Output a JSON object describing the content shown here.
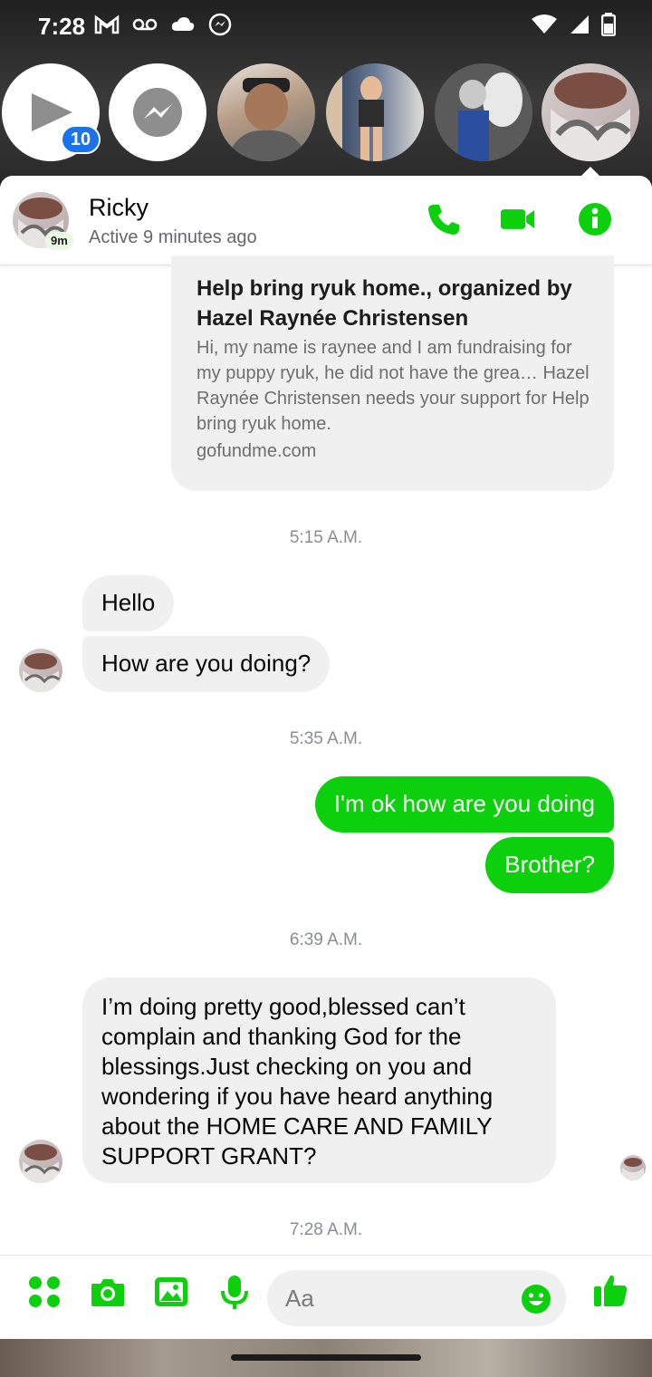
{
  "status_bar": {
    "time": "7:28"
  },
  "chat_heads": {
    "unread_badge": "10"
  },
  "header": {
    "name": "Ricky",
    "status": "Active 9 minutes ago",
    "active_badge": "9m"
  },
  "link_card": {
    "title": "Help bring ryuk home., organized by Hazel Raynée Christensen",
    "description": "Hi, my name is raynee and I am fundraising for my puppy ryuk, he did not have the grea… Hazel Raynée Christensen needs your support for Help bring ryuk home.",
    "domain": "gofundme.com"
  },
  "messages": {
    "ts1": "5:15 A.M.",
    "m1": "Hello",
    "m2": "How are you doing?",
    "ts2": "5:35 A.M.",
    "m3": "I'm ok how are you doing",
    "m4": "Brother?",
    "ts3": "6:39 A.M.",
    "m5": "I’m doing pretty good,blessed can’t complain and thanking God for the blessings.Just checking on you and wondering if you have heard anything about the HOME CARE AND FAMILY SUPPORT GRANT?",
    "ts4": "7:28 A.M."
  },
  "composer": {
    "placeholder": "Aa"
  },
  "colors": {
    "accent": "#0bd00b",
    "bubble_in": "#f0f0f0",
    "badge": "#1a73e8"
  },
  "icons": [
    "play-icon",
    "messenger-icon",
    "phone-icon",
    "video-camera-icon",
    "info-icon",
    "apps-icon",
    "camera-icon",
    "gallery-icon",
    "microphone-icon",
    "emoji-icon",
    "thumbs-up-icon"
  ]
}
